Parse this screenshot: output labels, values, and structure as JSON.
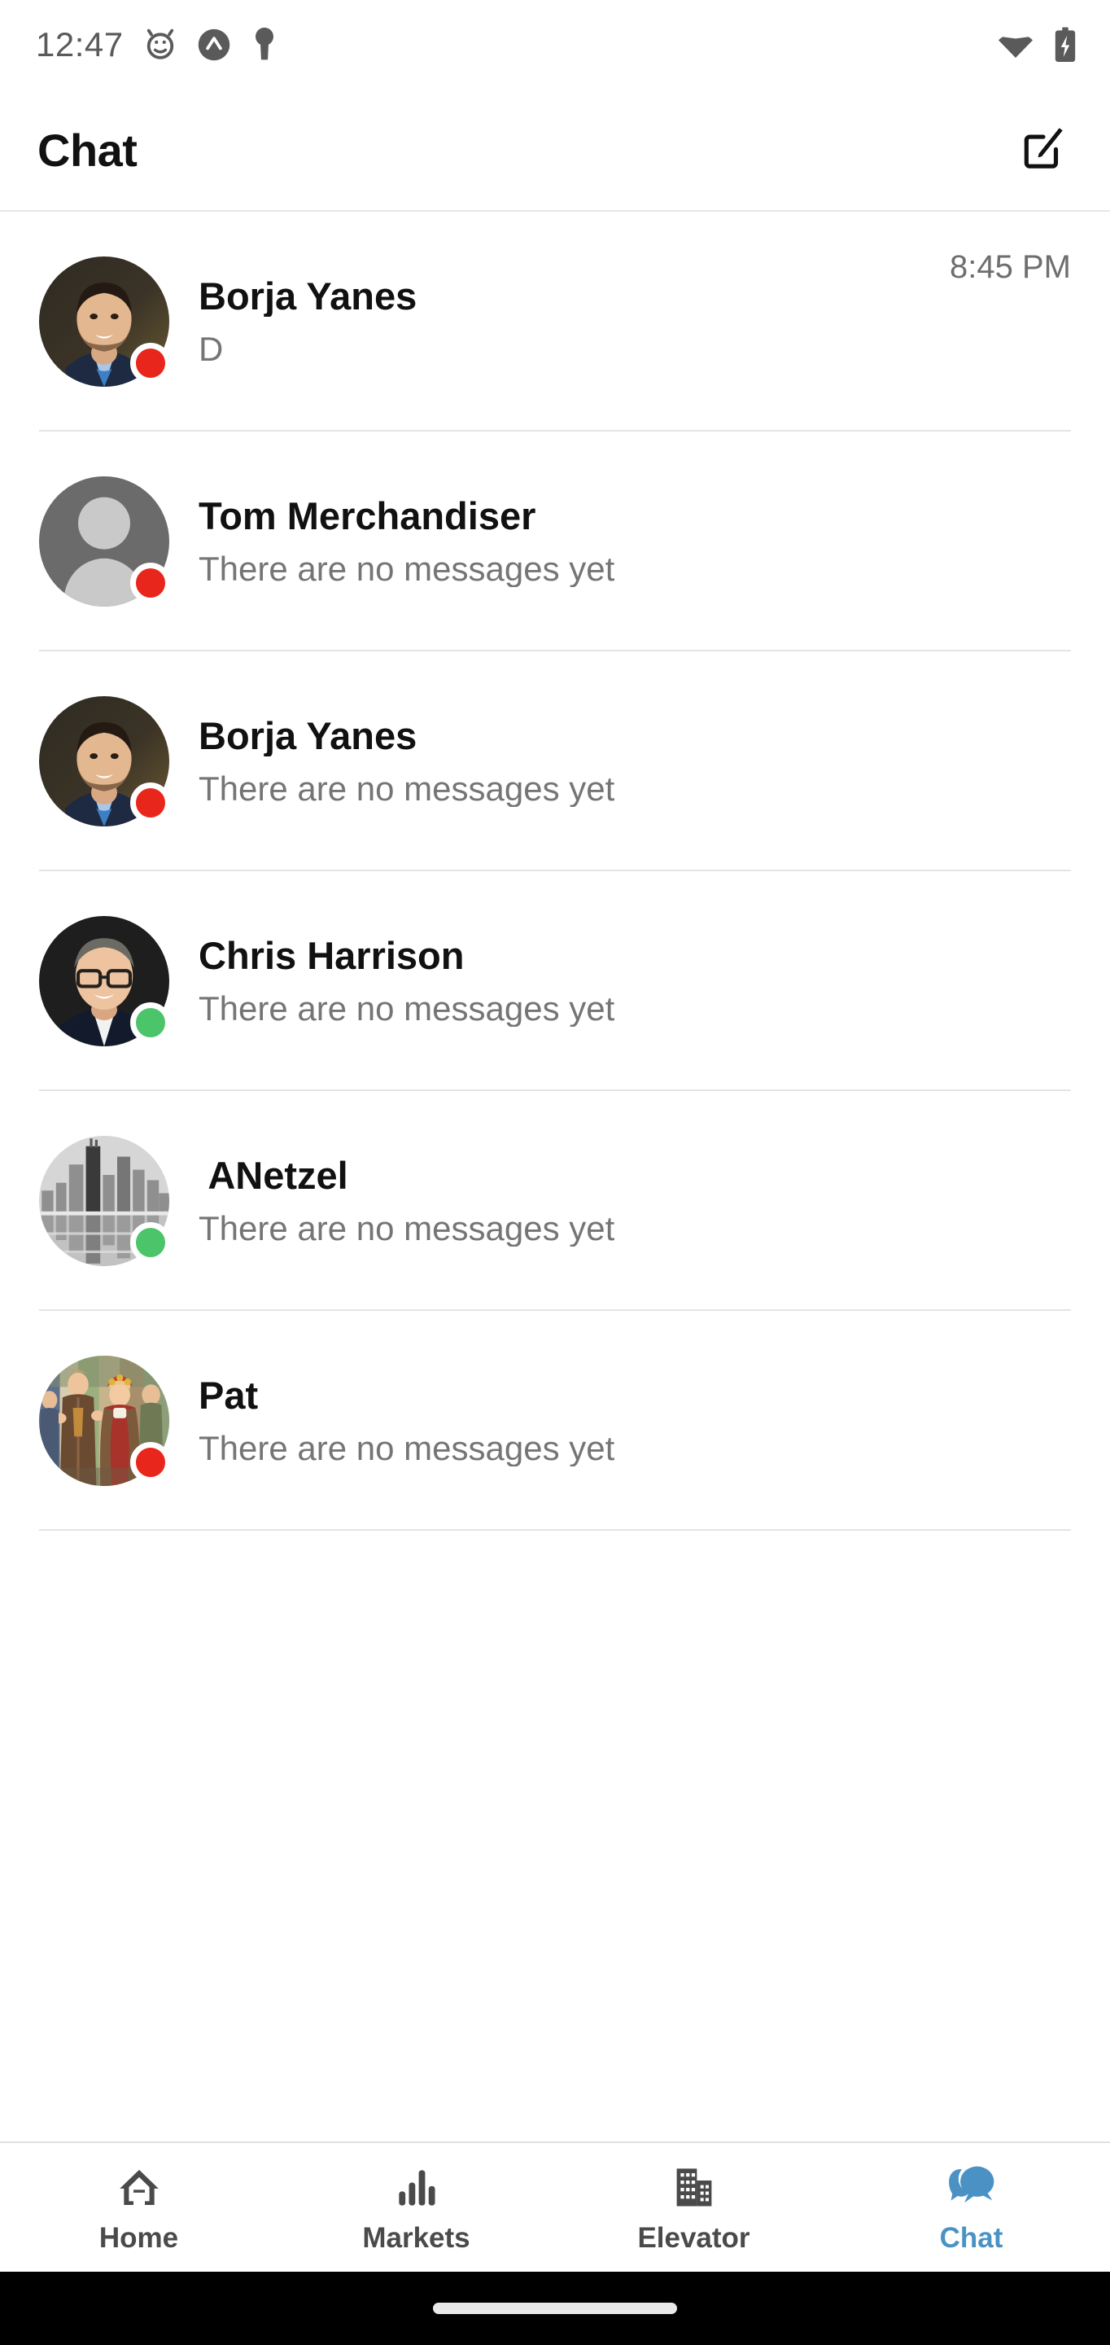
{
  "status_bar": {
    "time": "12:47",
    "left_icons": [
      "alarm-clock-icon",
      "circle-chevron-icon",
      "key-icon"
    ],
    "right_icons": [
      "wifi-icon",
      "battery-charging-icon"
    ]
  },
  "header": {
    "title": "Chat",
    "compose_icon": "compose-edit-icon"
  },
  "chats": [
    {
      "name": "Borja Yanes",
      "preview": "D",
      "time": "8:45 PM",
      "status": "offline",
      "avatar_type": "photo-man-beard"
    },
    {
      "name": "Tom Merchandiser",
      "preview": "There are no messages yet",
      "time": "",
      "status": "offline",
      "avatar_type": "placeholder-person"
    },
    {
      "name": "Borja Yanes",
      "preview": "There are no messages yet",
      "time": "",
      "status": "offline",
      "avatar_type": "photo-man-beard"
    },
    {
      "name": "Chris Harrison",
      "preview": "There are no messages yet",
      "time": "",
      "status": "online",
      "avatar_type": "photo-man-glasses"
    },
    {
      "name": " ANetzel",
      "preview": "There are no messages yet",
      "time": "",
      "status": "online",
      "avatar_type": "photo-city-skyline"
    },
    {
      "name": "Pat",
      "preview": "There are no messages yet",
      "time": "",
      "status": "offline",
      "avatar_type": "photo-group-costumes"
    }
  ],
  "bottom_nav": {
    "items": [
      {
        "label": "Home",
        "icon": "home-icon",
        "active": false
      },
      {
        "label": "Markets",
        "icon": "bar-chart-icon",
        "active": false
      },
      {
        "label": "Elevator",
        "icon": "building-icon",
        "active": false
      },
      {
        "label": "Chat",
        "icon": "chat-bubble-icon",
        "active": true
      }
    ]
  },
  "colors": {
    "accent": "#4B92C4",
    "status_online": "#4CC46A",
    "status_offline": "#E8261C",
    "text_primary": "#111111",
    "text_secondary": "#757575",
    "divider": "#e4e4e4"
  }
}
